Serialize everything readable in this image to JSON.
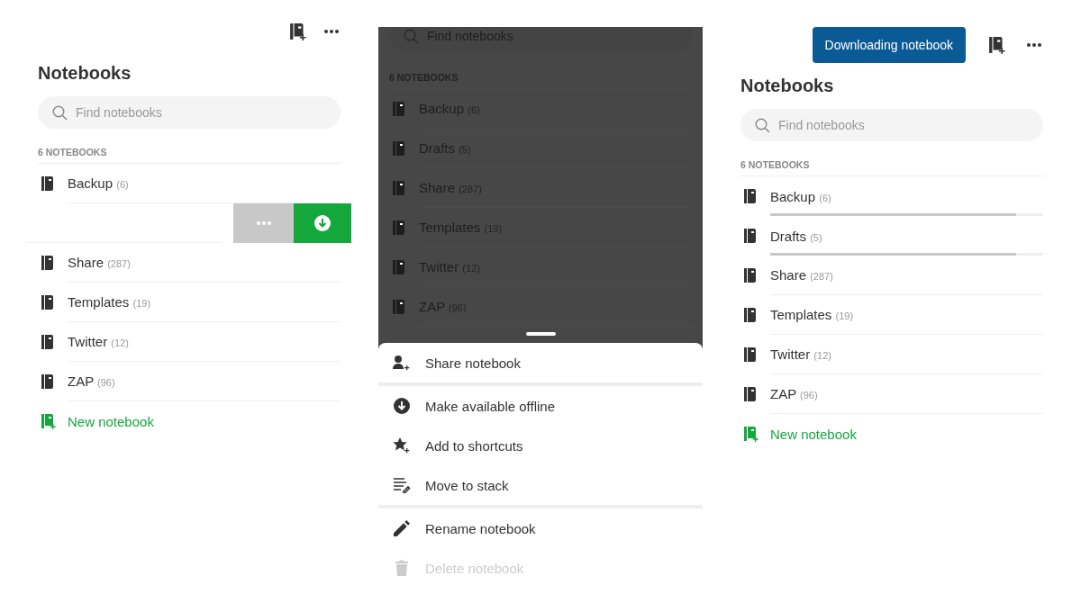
{
  "screens": [
    {
      "kind": "swipe",
      "title": "Notebooks",
      "search": {
        "placeholder": "Find notebooks"
      },
      "count_label": "6 NOTEBOOKS",
      "notebooks": [
        {
          "kind": "notebook",
          "name": "Backup",
          "count": "(6)"
        },
        {
          "kind": "swiped"
        },
        {
          "kind": "notebook",
          "name": "Share",
          "count": "(287)"
        },
        {
          "kind": "notebook",
          "name": "Templates",
          "count": "(19)"
        },
        {
          "kind": "notebook",
          "name": "Twitter",
          "count": "(12)"
        },
        {
          "kind": "notebook",
          "name": "ZAP",
          "count": "(96)"
        }
      ],
      "new_notebook": "New notebook"
    },
    {
      "kind": "sheet",
      "dimmed": true,
      "search": {
        "placeholder": "Find notebooks"
      },
      "count_label": "6 NOTEBOOKS",
      "notebooks": [
        {
          "kind": "notebook",
          "name": "Backup",
          "count": "(6)"
        },
        {
          "kind": "notebook",
          "name": "Drafts",
          "count": "(5)"
        },
        {
          "kind": "notebook",
          "name": "Share",
          "count": "(287)"
        },
        {
          "kind": "notebook",
          "name": "Templates",
          "count": "(19)"
        },
        {
          "kind": "notebook",
          "name": "Twitter",
          "count": "(12)"
        },
        {
          "kind": "notebook",
          "name": "ZAP",
          "count": "(96)"
        }
      ],
      "sheet": {
        "sections": [
          [
            {
              "kind": "share",
              "label": "Share notebook",
              "disabled": false
            }
          ],
          [
            {
              "kind": "offline",
              "label": "Make available offline",
              "disabled": false
            },
            {
              "kind": "shortcut",
              "label": "Add to shortcuts",
              "disabled": false
            },
            {
              "kind": "move",
              "label": "Move to stack",
              "disabled": false
            }
          ],
          [
            {
              "kind": "rename",
              "label": "Rename notebook",
              "disabled": false
            },
            {
              "kind": "delete",
              "label": "Delete notebook",
              "disabled": true
            }
          ]
        ]
      }
    },
    {
      "kind": "download",
      "header": {
        "toast": "Downloading notebook"
      },
      "title": "Notebooks",
      "search": {
        "placeholder": "Find notebooks"
      },
      "count_label": "6 NOTEBOOKS",
      "notebooks": [
        {
          "kind": "notebook",
          "name": "Backup",
          "count": "(6)",
          "level": 0.9
        },
        {
          "kind": "notebook",
          "name": "Drafts",
          "count": "(5)",
          "level": 0.9
        },
        {
          "kind": "notebook",
          "name": "Share",
          "count": "(287)"
        },
        {
          "kind": "notebook",
          "name": "Templates",
          "count": "(19)"
        },
        {
          "kind": "notebook",
          "name": "Twitter",
          "count": "(12)"
        },
        {
          "kind": "notebook",
          "name": "ZAP",
          "count": "(96)"
        }
      ],
      "new_notebook": "New notebook"
    }
  ]
}
